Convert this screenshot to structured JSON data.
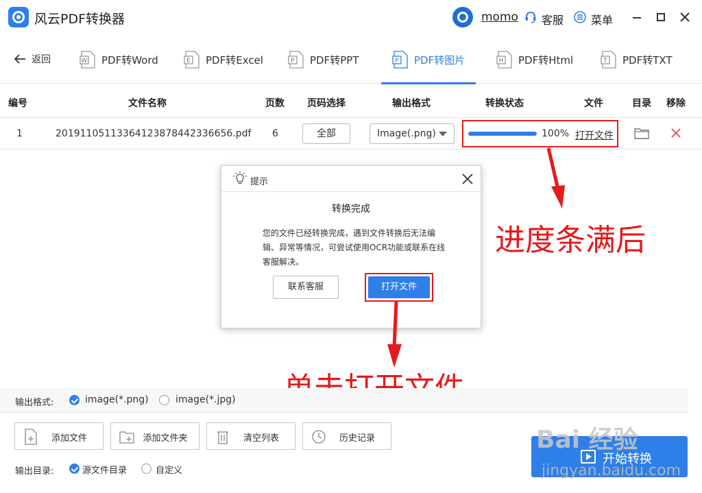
{
  "titlebar": {
    "app_title": "风云PDF转换器",
    "username": "momo",
    "support_label": "客服",
    "menu_label": "菜单"
  },
  "nav": {
    "back_label": "返回",
    "tabs": [
      {
        "label": "PDF转Word",
        "icon_letter": "W"
      },
      {
        "label": "PDF转Excel",
        "icon_letter": "E"
      },
      {
        "label": "PDF转PPT",
        "icon_letter": "P"
      },
      {
        "label": "PDF转图片",
        "icon_letter": "P"
      },
      {
        "label": "PDF转Html",
        "icon_letter": "H"
      },
      {
        "label": "PDF转TXT",
        "icon_letter": "T"
      }
    ],
    "active_tab": "PDF转图片"
  },
  "table": {
    "headers": [
      "编号",
      "文件名称",
      "页数",
      "页码选择",
      "输出格式",
      "转换状态",
      "文件",
      "目录",
      "移除"
    ],
    "rows": [
      {
        "index": "1",
        "filename": "20191105113364123878442336656.pdf",
        "pages": "6",
        "page_selection": "全部",
        "output_format": "Image(.png)",
        "progress": 1.0,
        "progress_text": "100%",
        "open_file": "打开文件"
      }
    ]
  },
  "dialog": {
    "title": "提示",
    "heading": "转换完成",
    "body": "您的文件已经转换完成，遇到文件转换后无法编辑、异常等情况，可尝试使用OCR功能或联系在线客服解决。",
    "contact_button": "联系客服",
    "open_button": "打开文件"
  },
  "annotations": {
    "progress_note": "进度条满后",
    "click_note": "单击打开文件"
  },
  "bottom": {
    "output_format_label": "输出格式:",
    "format_options": [
      "image(*.png)",
      "image(*.jpg)"
    ],
    "selected_format": "image(*.png)",
    "buttons": [
      "添加文件",
      "添加文件夹",
      "清空列表",
      "历史记录"
    ],
    "output_dir_label": "输出目录:",
    "dir_options": [
      "源文件目录",
      "自定义"
    ],
    "selected_dir": "源文件目录",
    "start_button": "开始转换"
  },
  "watermark": {
    "text": "Bai 经验",
    "sub": "jingyan.baidu.com"
  },
  "colors": {
    "accent": "#2f7fe8",
    "annotation_red": "#e8191a"
  }
}
